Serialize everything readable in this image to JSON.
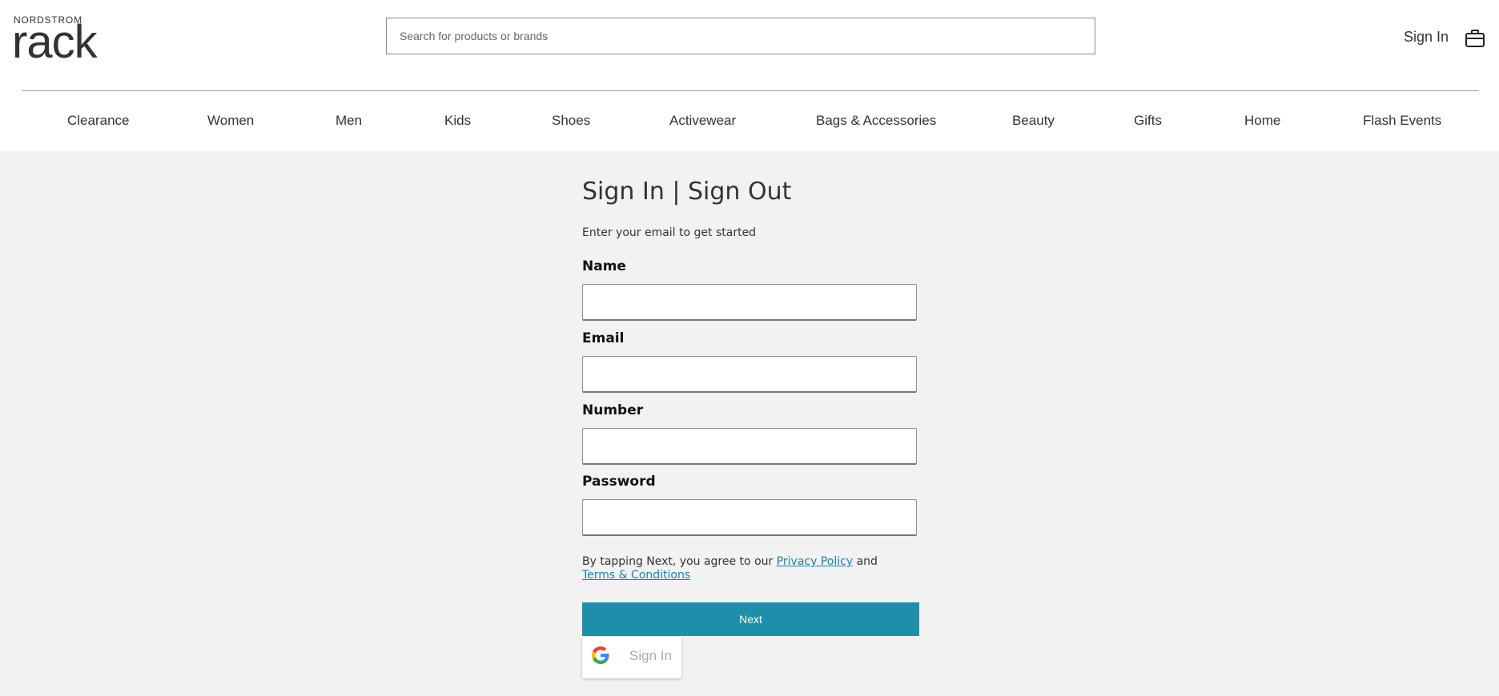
{
  "header": {
    "logo_top": "NORDSTROM",
    "logo_bottom": "rack",
    "search_placeholder": "Search for products or brands",
    "sign_in_label": "Sign In",
    "bag_icon": "shopping-bag-icon"
  },
  "nav": {
    "items": [
      "Clearance",
      "Women",
      "Men",
      "Kids",
      "Shoes",
      "Activewear",
      "Bags & Accessories",
      "Beauty",
      "Gifts",
      "Home",
      "Flash Events"
    ]
  },
  "form": {
    "title": "Sign In | Sign Out",
    "subtitle": "Enter your email to get started",
    "name_label": "Name",
    "email_label": "Email",
    "number_label": "Number",
    "password_label": "Password",
    "name_value": "",
    "email_value": "",
    "number_value": "",
    "password_value": "",
    "terms_prefix": "By tapping Next, you agree to our ",
    "privacy_link": "Privacy Policy",
    "terms_and": " and",
    "terms_link": "Terms & Conditions",
    "next_label": "Next",
    "google_label": "Sign In",
    "google_icon": "google-icon"
  },
  "colors": {
    "accent": "#1e8fab",
    "link": "#1f7fa8",
    "background": "#f2f2f2"
  }
}
